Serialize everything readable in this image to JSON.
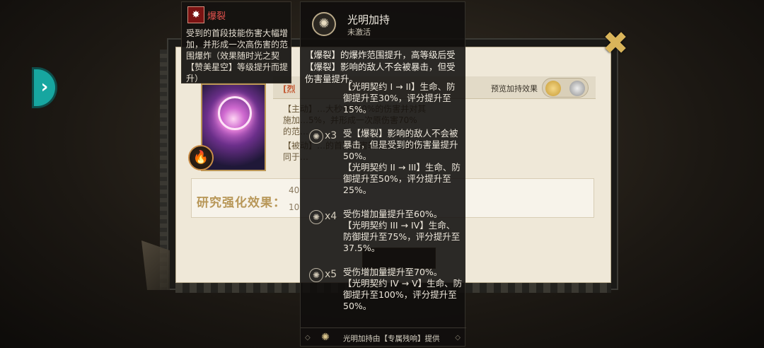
{
  "nav": {
    "chevron": "›",
    "close": "✖"
  },
  "left_tooltip": {
    "icon": "burst-icon",
    "title": "爆裂",
    "description": "受到的首段技能伤害大幅增加，并形成一次高伤害的范围爆炸（效果随时光之契【赞美星空】等级提升而提升）"
  },
  "main_tooltip": {
    "title": "光明加持",
    "status": "未激活",
    "intro": "【爆裂】的爆炸范围提升，高等级后受【爆裂】影响的敌人不会被暴击，但受伤害量提升。",
    "tiers": [
      {
        "mult": "",
        "text": "【光明契约 I → II】生命、防御提升至30%，评分提升至15%。"
      },
      {
        "mult": "x3",
        "text": "受【爆裂】影响的敌人不会被暴击，但是受到的伤害量提升50%。"
      },
      {
        "mult": "",
        "text": "【光明契约 II → III】生命、防御提升至50%，评分提升至25%。"
      },
      {
        "mult": "x4",
        "text": "受伤增加量提升至60%。"
      },
      {
        "mult": "",
        "text": "【光明契约 III → IV】生命、防御提升至75%，评分提升至37.5%。"
      },
      {
        "mult": "x5",
        "text": "受伤增加量提升至70%。"
      },
      {
        "mult": "",
        "text": "【光明契约 IV → V】生命、防御提升至100%，评分提升至50%。"
      }
    ],
    "footer": "光明加持由【专属残响】提供",
    "footer_deco": "◇"
  },
  "background": {
    "tag": "[烈",
    "preview_label": "预览加持效果",
    "lines": [
      "【主动】…大秒伤250%的伤害并对其",
      "施加…5%，并形成一次原伤害70%",
      "的范…",
      "【被动】…的首段伤害转化成一次等",
      "同于…"
    ],
    "research_label": "研究强化效果：",
    "research_values": [
      "40",
      "10"
    ],
    "card_badge": "🔥"
  }
}
